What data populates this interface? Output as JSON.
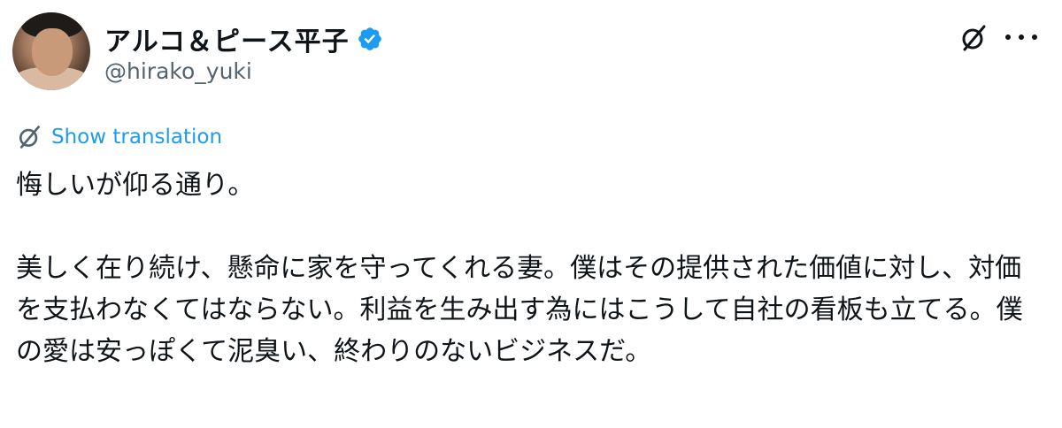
{
  "author": {
    "display_name": "アルコ＆ピース平子",
    "handle": "@hirako_yuki",
    "verified": true,
    "avatar_icon": "profile-photo"
  },
  "actions": {
    "grok_icon": "grok-slash-circle-icon",
    "more_icon": "more-dots-icon"
  },
  "translate": {
    "label": "Show translation",
    "icon": "grok-slash-circle-icon"
  },
  "tweet": {
    "text": "悔しいが仰る通り。\n\n美しく在り続け、懸命に家を守ってくれる妻。僕はその提供された価値に対し、対価を支払わなくてはならない。利益を生み出す為にはこうして自社の看板も立てる。僕の愛は安っぽくて泥臭い、終わりのないビジネスだ。"
  },
  "colors": {
    "accent": "#1d9bf0",
    "text_primary": "#0f1419",
    "text_secondary": "#536471"
  }
}
